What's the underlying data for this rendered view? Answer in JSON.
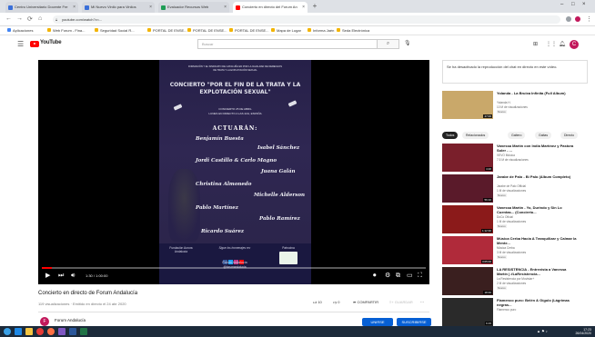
{
  "browser": {
    "tabs": [
      {
        "label": "Centro Universitario Docente Fre",
        "color": "#3a6fd8",
        "active": false
      },
      {
        "label": "Mi Nuevo Vinilo para Vinilos",
        "color": "#3a6fd8",
        "active": false
      },
      {
        "label": "Evaluador Recursos Web",
        "color": "#1f9d55",
        "active": false
      },
      {
        "label": "Concierto en directo del Forum An",
        "color": "#ff0000",
        "active": true
      }
    ],
    "new_tab": "+",
    "url": "youtube.com/watch?v=...",
    "bookmarks": [
      "Aplicaciones",
      "Web Forum - Fina...",
      "Seguridad Social R...",
      "PORTAL DE ENSE...",
      "PORTAL DE ENSE...",
      "PORTAL DE ENSE...",
      "Mapa de Lugar",
      "Informa Jaén",
      "Seda Electrónica"
    ]
  },
  "youtube": {
    "logo_text": "YouTube",
    "logo_region": "ES",
    "search_placeholder": "Buscar",
    "avatar_letter": "C"
  },
  "poster": {
    "header_lines": [
      "FORMACIÓN Y EL SINDICATO DE CATALUÑA EN POR LA IGUALDAD DE DERECHOS",
      "DE TRATA Y LA EXPLOTACIÓN SEXUAL"
    ],
    "title_line1": "CONCIERTO \"POR EL FIN DE LA TRATA Y LA",
    "title_line2": "EXPLOTACIÓN SEXUAL\"",
    "date_line1": "CONCIERTO 25 DE ABRIL",
    "date_line2": "LUNES EN DIRECTO A LAS 22H, ESPAÑA",
    "performers_heading": "ACTUARÁN:",
    "performers": [
      "Benjamín Buesta",
      "Isabel Sánchez",
      "Jordi Castillo & Carlo Magno",
      "Juana Galán",
      "Christina Almonedo",
      "Michelle Alderson",
      "Pablo Martínez",
      "Pablo Ramírez",
      "Ricardo Suárez"
    ],
    "footer_left": "Fundación Aurora\nAndalucía",
    "footer_center_title": "Sigue los homenajes en:",
    "footer_center_sub": "Forum Andalucía",
    "footer_center_handle": "@forumandalucia",
    "footer_right": "Patrocina"
  },
  "player": {
    "timecode": "1:30 / 1:00:00",
    "progress_fraction": 0.025
  },
  "video": {
    "title": "Concierto en directo de Forum Andalucía",
    "meta": "119 visualizaciones · Emitido en directo el 24 abr 2020",
    "likes": "10",
    "dislikes": "0",
    "share_label": "COMPARTIR",
    "save_label": "GUARDAR",
    "channel_name": "Forum Andalucía",
    "channel_initial": "F",
    "join_button": "UNIRSE",
    "subscribe_button": "SUSCRIBIRSE"
  },
  "sidebar": {
    "chat_note": "Se ha desactivado la reproducción del chat en directo en este vídeo.",
    "chips": [
      "Todos",
      "Relacionados",
      "Gaitero",
      "Gaitas",
      "Directo"
    ],
    "recommendations": [
      {
        "title": "Yolanda - La Bruixa Infinita (Full Album)",
        "channel": "Yolanda H.",
        "views": "10 M de visualizaciones",
        "badge": "Nuevo",
        "duration": "47:00",
        "thumb": "#c9a86a"
      },
      {
        "title": "Vanessa Martín con India Martínez y Pastora Soler - ...",
        "channel": "VEVO Música",
        "views": "7.5 M de visualizaciones",
        "badge": "",
        "duration": "4:20",
        "thumb": "#7a1f2b"
      },
      {
        "title": "Jarabe de Palo - Bi Palo (Album Completo)",
        "channel": "Jarabe de Palo Official",
        "views": "1 M de visualizaciones",
        "badge": "Nuevo",
        "duration": "56:10",
        "thumb": "#5a1a2a"
      },
      {
        "title": "Vanessa Martín - Yo, Durindo y Sin Lo Cuentas... (Concierto...",
        "channel": "DoCo Oficial",
        "views": "1 M de visualizaciones",
        "badge": "Nuevo",
        "duration": "1:12:30",
        "thumb": "#8b1a1a"
      },
      {
        "title": "Música Cerba Hacia A Tranquilizar y Calmar la Mente...",
        "channel": "Música Cerba",
        "views": "3 M de visualizaciones",
        "badge": "Nuevo",
        "duration": "3:05:00",
        "thumb": "#b02a3a"
      },
      {
        "title": "LA RESISTENCIA - Entrevista a Vanessa Martín | #LaResistencia...",
        "channel": "La Resistencia por Movistar+",
        "views": "2 M de visualizaciones",
        "badge": "Nuevo",
        "duration": "18:40",
        "thumb": "#3a1f1f"
      },
      {
        "title": "Flamenco puro: Belén & Gígolo (Lágrimas negras...",
        "channel": "Flamenco puro",
        "views": "900 K de visualizaciones",
        "badge": "",
        "duration": "6:15",
        "thumb": "#2a2a2a"
      }
    ]
  },
  "taskbar": {
    "time": "17:23",
    "date": "26/04/2020",
    "apps": [
      "start",
      "ie",
      "explorer",
      "chrome",
      "firefox",
      "media",
      "word",
      "excel"
    ]
  }
}
